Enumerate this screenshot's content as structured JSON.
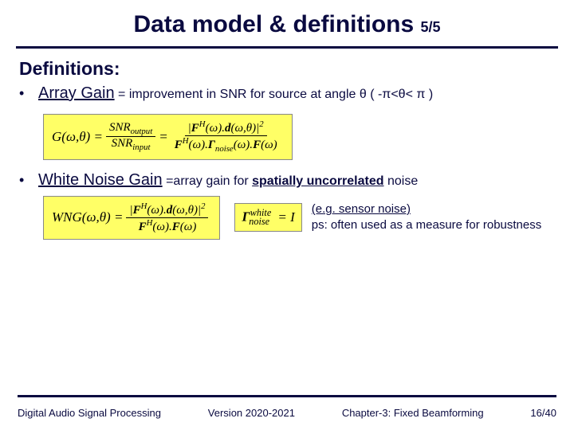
{
  "title": {
    "main": "Data model & definitions",
    "part": "5/5"
  },
  "heading": "Definitions:",
  "bullets": [
    {
      "term": "Array Gain",
      "eq_text": " = improvement in SNR for source at angle θ   ( -π<θ< π )"
    },
    {
      "term": "White Noise Gain",
      "eq_text": " =array gain for "
    }
  ],
  "uncorrelated": "spatially uncorrelated",
  "noise_word": " noise",
  "formulas": {
    "array_gain": {
      "lhs": "G(ω,θ) = ",
      "num1": "SNR",
      "num1_sub": "output",
      "den1": "SNR",
      "den1_sub": "input",
      "mid": " = ",
      "num2_open": "|",
      "num2_F": "F",
      "num2_sup": "H",
      "num2_arg": "(ω).",
      "num2_d": "d",
      "num2_rest": "(ω,θ)|",
      "num2_sq": "2",
      "den2_F1": "F",
      "den2_sup1": "H",
      "den2_arg1": "(ω).",
      "den2_G": "Γ",
      "den2_gsub": "noise",
      "den2_arg2": "(ω).",
      "den2_F2": "F",
      "den2_arg3": "(ω)"
    },
    "wng": {
      "lhs": "WNG(ω,θ) = ",
      "num_open": "|",
      "num_F": "F",
      "num_sup": "H",
      "num_arg": "(ω).",
      "num_d": "d",
      "num_rest": "(ω,θ)|",
      "num_sq": "2",
      "den_F1": "F",
      "den_sup1": "H",
      "den_arg1": "(ω).",
      "den_F2": "F",
      "den_arg2": "(ω)"
    },
    "gamma_box": {
      "G": "Γ",
      "sup": "white",
      "sub": "noise",
      "eq": " = I"
    }
  },
  "notes": {
    "l1": "(e.g. sensor noise)",
    "l2": "ps: often used as a measure for robustness"
  },
  "footer": {
    "left": "Digital Audio Signal Processing",
    "mid": "Version 2020-2021",
    "chapter": "Chapter-3: Fixed Beamforming",
    "page": "16/40"
  }
}
